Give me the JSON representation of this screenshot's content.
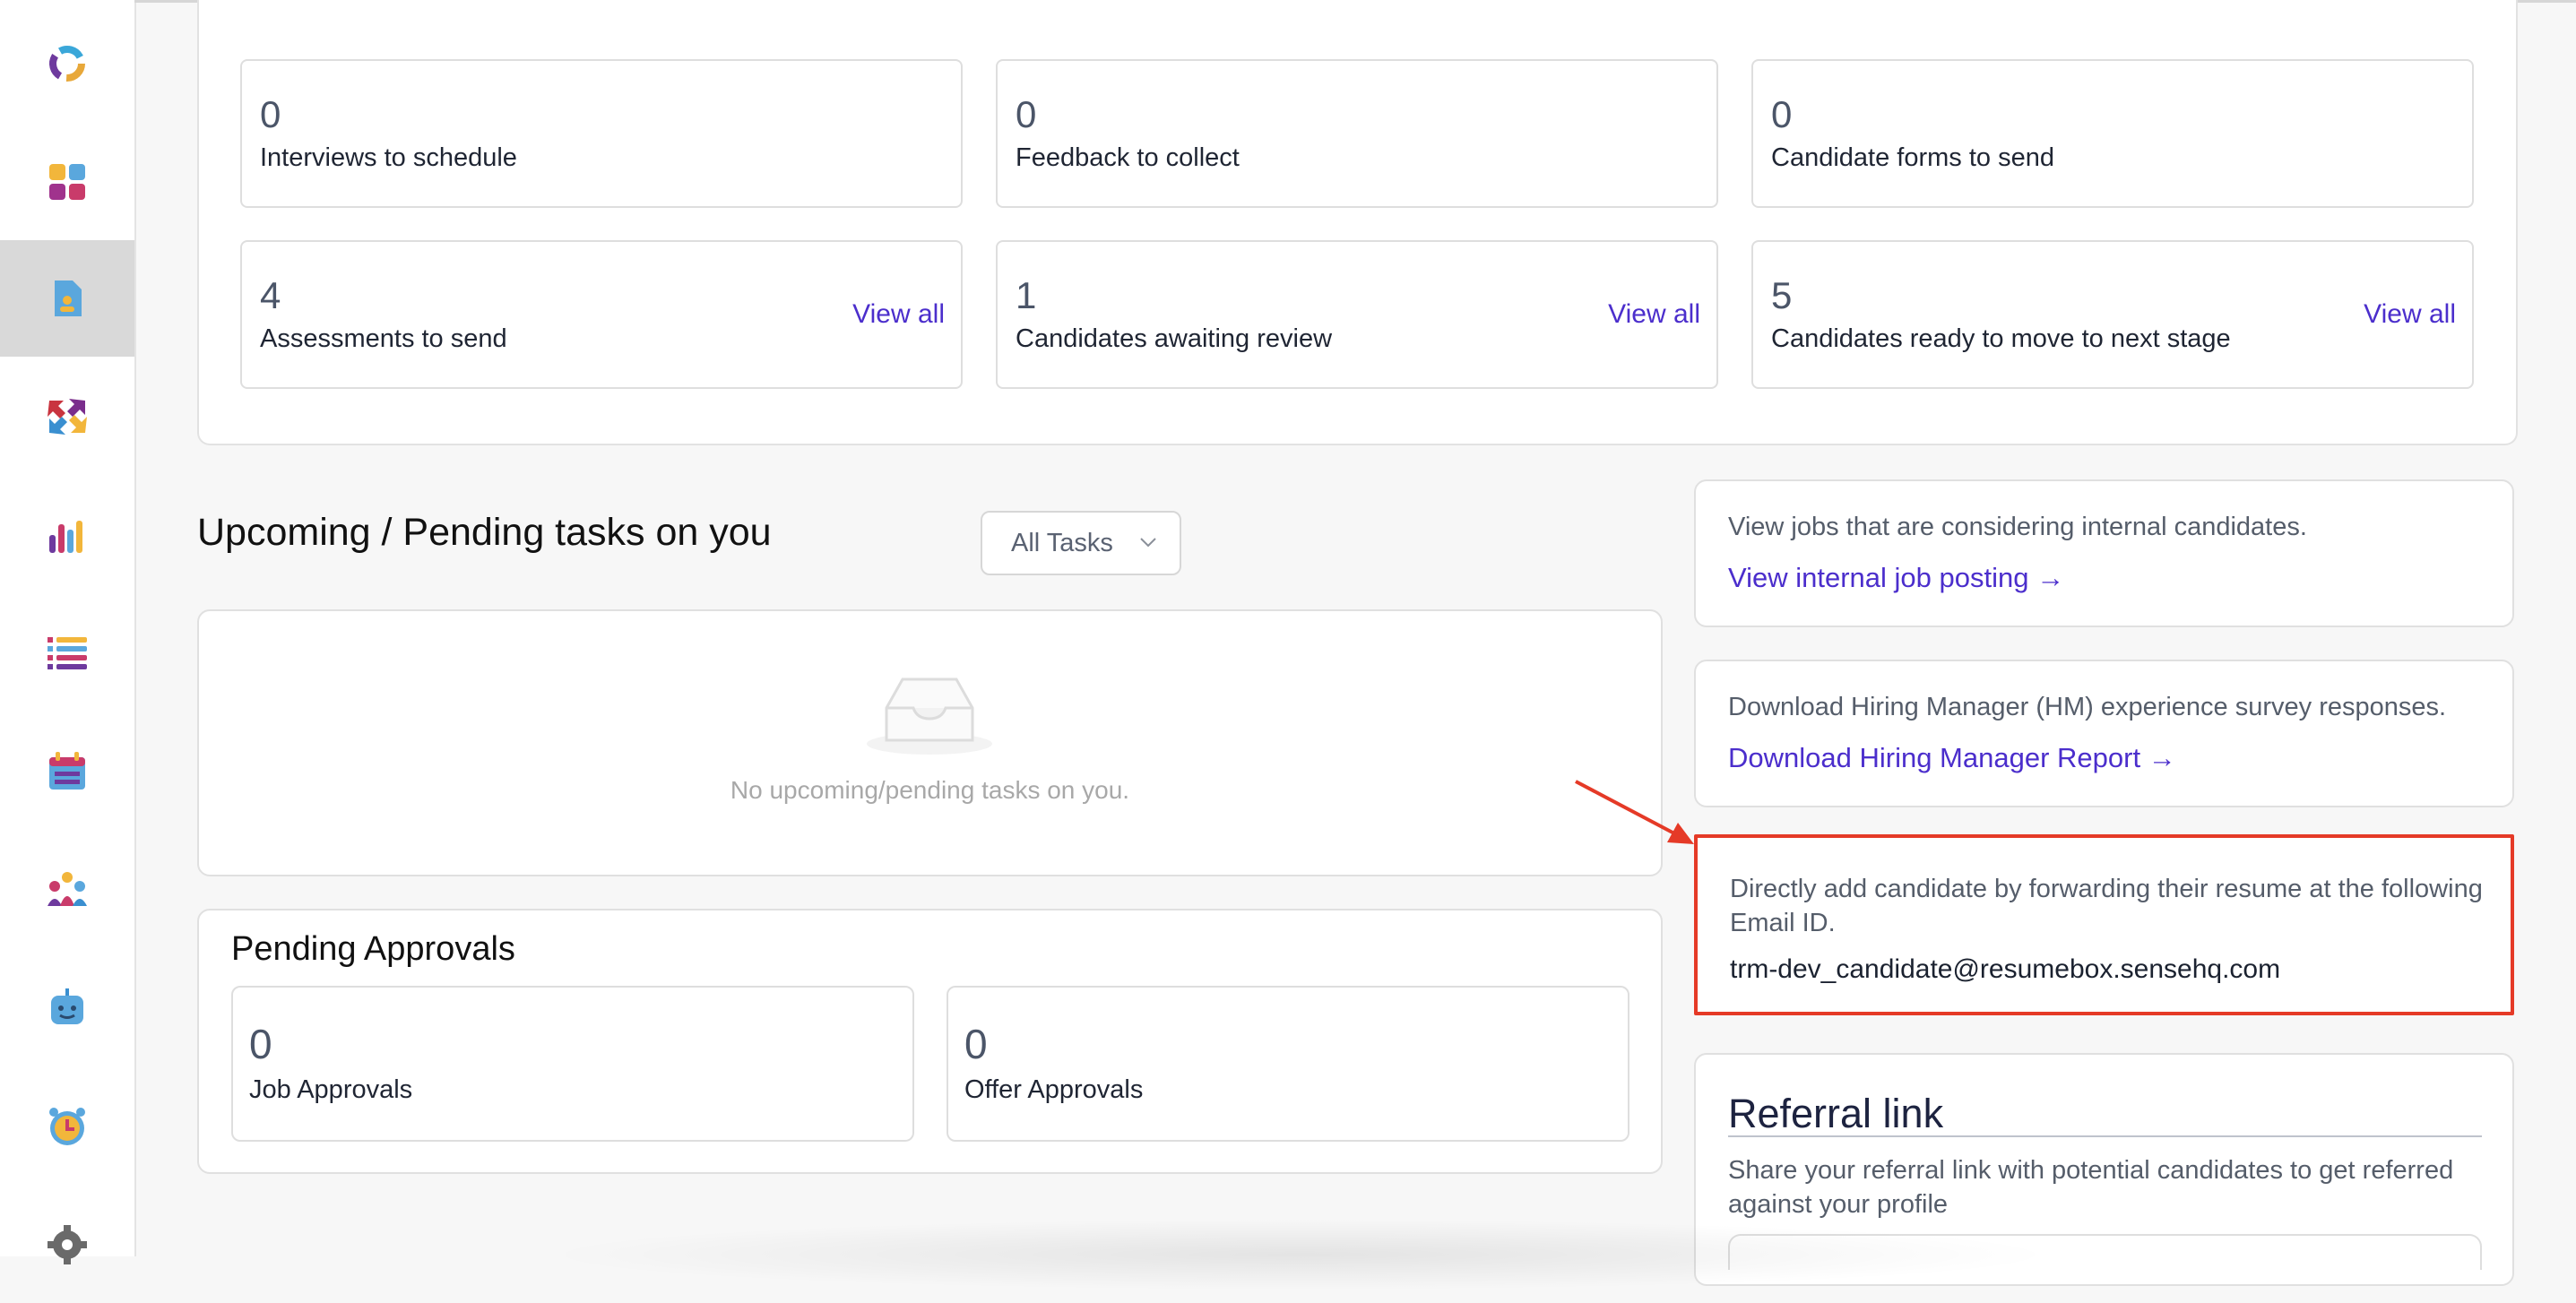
{
  "stats": [
    {
      "value": "0",
      "label": "Interviews to schedule",
      "link": ""
    },
    {
      "value": "0",
      "label": "Feedback to collect",
      "link": ""
    },
    {
      "value": "0",
      "label": "Candidate forms to send",
      "link": ""
    },
    {
      "value": "4",
      "label": "Assessments to send",
      "link": "View all"
    },
    {
      "value": "1",
      "label": "Candidates awaiting review",
      "link": "View all"
    },
    {
      "value": "5",
      "label": "Candidates ready to move to next stage",
      "link": "View all"
    }
  ],
  "tasks": {
    "title": "Upcoming / Pending tasks on you",
    "filter": "All Tasks",
    "empty": "No upcoming/pending tasks on you."
  },
  "approvals": {
    "title": "Pending Approvals",
    "items": [
      {
        "value": "0",
        "label": "Job Approvals"
      },
      {
        "value": "0",
        "label": "Offer Approvals"
      }
    ]
  },
  "internal_jobs": {
    "text": "View jobs that are considering internal candidates.",
    "link": "View internal job posting →"
  },
  "hm_report": {
    "text": "Download Hiring Manager (HM) experience survey responses.",
    "link": "Download Hiring Manager Report →"
  },
  "email_forward": {
    "text": "Directly add candidate by forwarding their resume at the following Email ID.",
    "email": "trm-dev_candidate@resumebox.sensehq.com"
  },
  "referral": {
    "title": "Referral link",
    "text": "Share your referral link with potential candidates to get referred against your profile"
  },
  "sidebar": {
    "icons": [
      "logo-icon",
      "dashboard-icon",
      "candidate-profile-icon",
      "transfer-arrows-icon",
      "analytics-icon",
      "list-icon",
      "calendar-icon",
      "team-icon",
      "chatbot-icon",
      "alarm-clock-icon",
      "settings-icon"
    ],
    "active_index": 2
  },
  "colors": {
    "accent": "#4b2ecc",
    "highlight": "#e53a27"
  }
}
